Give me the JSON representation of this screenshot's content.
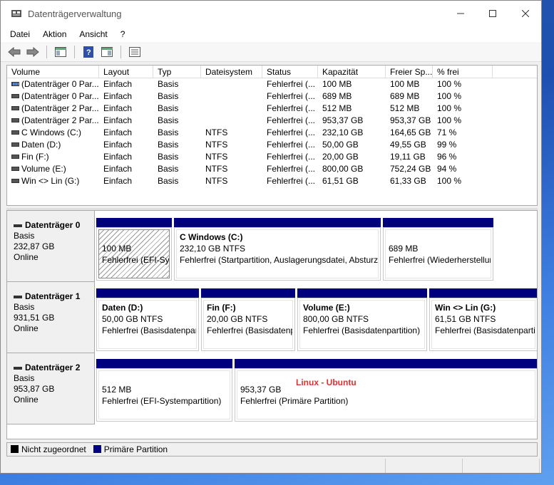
{
  "window": {
    "title": "Datenträgerverwaltung"
  },
  "menu": [
    "Datei",
    "Aktion",
    "Ansicht",
    "?"
  ],
  "list": {
    "columns": [
      "Volume",
      "Layout",
      "Typ",
      "Dateisystem",
      "Status",
      "Kapazität",
      "Freier Sp...",
      "% frei"
    ],
    "rows": [
      [
        "(Datenträger 0 Par...",
        "Einfach",
        "Basis",
        "",
        "Fehlerfrei (...",
        "100 MB",
        "100 MB",
        "100 %"
      ],
      [
        "(Datenträger 0 Par...",
        "Einfach",
        "Basis",
        "",
        "Fehlerfrei (...",
        "689 MB",
        "689 MB",
        "100 %"
      ],
      [
        "(Datenträger 2 Par...",
        "Einfach",
        "Basis",
        "",
        "Fehlerfrei (...",
        "512 MB",
        "512 MB",
        "100 %"
      ],
      [
        "(Datenträger 2 Par...",
        "Einfach",
        "Basis",
        "",
        "Fehlerfrei (...",
        "953,37 GB",
        "953,37 GB",
        "100 %"
      ],
      [
        "C Windows (C:)",
        "Einfach",
        "Basis",
        "NTFS",
        "Fehlerfrei (...",
        "232,10 GB",
        "164,65 GB",
        "71 %"
      ],
      [
        "Daten (D:)",
        "Einfach",
        "Basis",
        "NTFS",
        "Fehlerfrei (...",
        "50,00 GB",
        "49,55 GB",
        "99 %"
      ],
      [
        "Fin (F:)",
        "Einfach",
        "Basis",
        "NTFS",
        "Fehlerfrei (...",
        "20,00 GB",
        "19,11 GB",
        "96 %"
      ],
      [
        "Volume (E:)",
        "Einfach",
        "Basis",
        "NTFS",
        "Fehlerfrei (...",
        "800,00 GB",
        "752,24 GB",
        "94 %"
      ],
      [
        "Win <> Lin (G:)",
        "Einfach",
        "Basis",
        "NTFS",
        "Fehlerfrei (...",
        "61,51 GB",
        "61,33 GB",
        "100 %"
      ]
    ]
  },
  "disks": [
    {
      "name": "Datenträger 0",
      "type": "Basis",
      "size": "232,87 GB",
      "state": "Online",
      "partitions": [
        {
          "name": "",
          "size": "100 MB",
          "status": "Fehlerfrei (EFI-Systempartition)"
        },
        {
          "name": "C Windows  (C:)",
          "size": "232,10 GB NTFS",
          "status": "Fehlerfrei (Startpartition, Auslagerungsdatei, Absturzabbild, Primäre Partition)"
        },
        {
          "name": "",
          "size": "689 MB",
          "status": "Fehlerfrei (Wiederherstellungspartition)"
        }
      ]
    },
    {
      "name": "Datenträger 1",
      "type": "Basis",
      "size": "931,51 GB",
      "state": "Online",
      "partitions": [
        {
          "name": "Daten  (D:)",
          "size": "50,00 GB NTFS",
          "status": "Fehlerfrei (Basisdatenpartition)"
        },
        {
          "name": "Fin  (F:)",
          "size": "20,00 GB NTFS",
          "status": "Fehlerfrei (Basisdatenpartition)"
        },
        {
          "name": "Volume  (E:)",
          "size": "800,00 GB NTFS",
          "status": "Fehlerfrei (Basisdatenpartition)"
        },
        {
          "name": "Win <> Lin  (G:)",
          "size": "61,51 GB NTFS",
          "status": "Fehlerfrei (Basisdatenpartition)"
        }
      ]
    },
    {
      "name": "Datenträger 2",
      "type": "Basis",
      "size": "953,87 GB",
      "state": "Online",
      "partitions": [
        {
          "name": "",
          "size": "512 MB",
          "status": "Fehlerfrei (EFI-Systempartition)"
        },
        {
          "name": "",
          "size": "953,37 GB",
          "status": "Fehlerfrei (Primäre Partition)",
          "note": "Linux - Ubuntu"
        }
      ]
    }
  ],
  "legend": [
    {
      "label": "Nicht zugeordnet",
      "color": "#000000"
    },
    {
      "label": "Primäre Partition",
      "color": "#00007f"
    }
  ],
  "colors": {
    "partition_bar": "#00007f",
    "note": "#e03030"
  }
}
